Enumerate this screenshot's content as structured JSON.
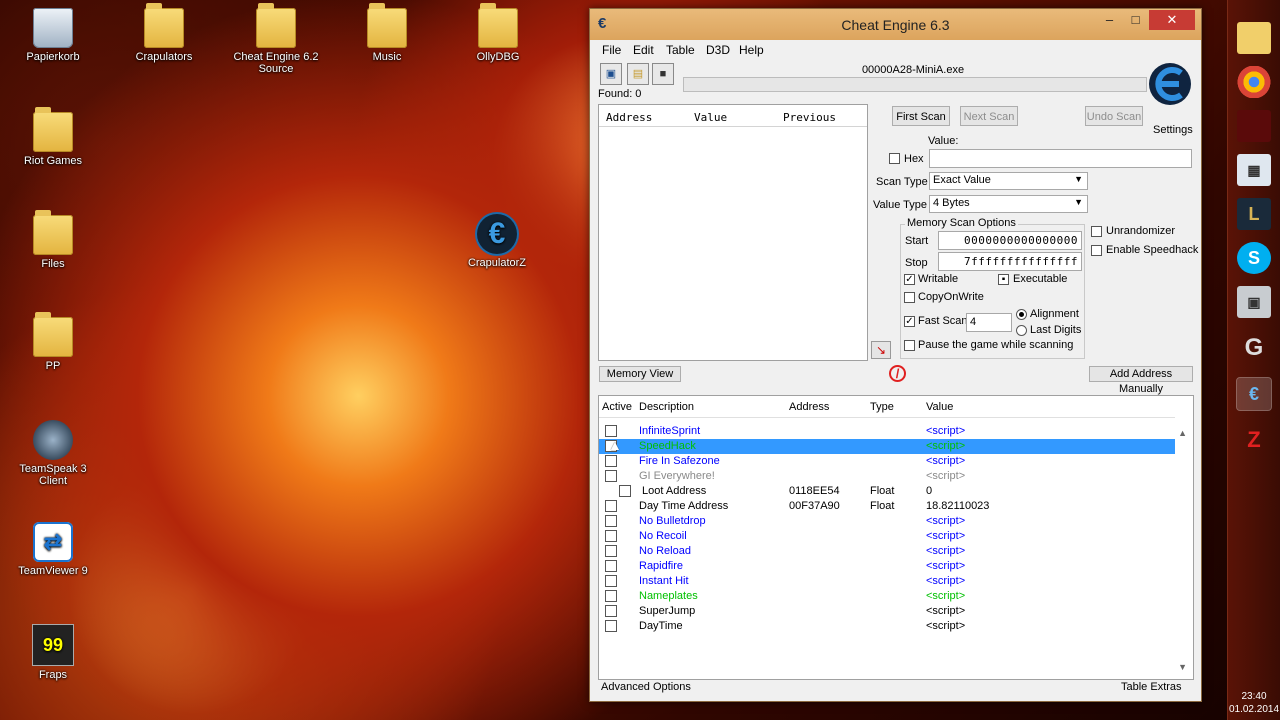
{
  "desktop": {
    "icons": [
      "Papierkorb",
      "Crapulators",
      "Cheat Engine 6.2 Source",
      "Music",
      "OllyDBG",
      "Riot Games",
      "Files",
      "CrapulatorZ",
      "PP",
      "TeamSpeak 3 Client",
      "TeamViewer 9",
      "Fraps"
    ]
  },
  "taskbar": {
    "time": "23:40",
    "date": "01.02.2014"
  },
  "window": {
    "title": "Cheat Engine 6.3",
    "menu": [
      "File",
      "Edit",
      "Table",
      "D3D",
      "Help"
    ],
    "process": "00000A28-MiniA.exe",
    "found": "Found: 0",
    "results_headers": [
      "Address",
      "Value",
      "Previous"
    ],
    "scan": {
      "first_scan": "First Scan",
      "next_scan": "Next Scan",
      "undo_scan": "Undo Scan",
      "settings": "Settings",
      "value_label": "Value:",
      "hex_label": "Hex",
      "scan_type_label": "Scan Type",
      "scan_type_value": "Exact Value",
      "value_type_label": "Value Type",
      "value_type_value": "4 Bytes",
      "memory_options_title": "Memory Scan Options",
      "start_label": "Start",
      "start_value": "0000000000000000",
      "stop_label": "Stop",
      "stop_value": "7fffffffffffffff",
      "writable": "Writable",
      "executable": "Executable",
      "copyonwrite": "CopyOnWrite",
      "fast_scan": "Fast Scan",
      "fast_scan_value": "4",
      "alignment": "Alignment",
      "last_digits": "Last Digits",
      "pause": "Pause the game while scanning",
      "unrandomizer": "Unrandomizer",
      "speedhack": "Enable Speedhack"
    },
    "memory_view": "Memory View",
    "add_address": "Add Address Manually",
    "table_headers": [
      "Active",
      "Description",
      "Address",
      "Type",
      "Value"
    ],
    "rows": [
      {
        "desc": "InfiniteSprint",
        "address": "",
        "type": "",
        "value": "<script>",
        "color": "blue"
      },
      {
        "desc": "SpeedHack",
        "address": "",
        "type": "",
        "value": "<script>",
        "color": "green"
      },
      {
        "desc": "Fire In Safezone",
        "address": "",
        "type": "",
        "value": "<script>",
        "color": "blue"
      },
      {
        "desc": "GI Everywhere!",
        "address": "",
        "type": "",
        "value": "<script>",
        "color": "gray"
      },
      {
        "desc": "Loot Address",
        "address": "0118EE54",
        "type": "Float",
        "value": "0",
        "color": "black"
      },
      {
        "desc": "Day Time Address",
        "address": "00F37A90",
        "type": "Float",
        "value": "18.82110023",
        "color": "black"
      },
      {
        "desc": "No Bulletdrop",
        "address": "",
        "type": "",
        "value": "<script>",
        "color": "blue"
      },
      {
        "desc": "No Recoil",
        "address": "",
        "type": "",
        "value": "<script>",
        "color": "blue"
      },
      {
        "desc": "No Reload",
        "address": "",
        "type": "",
        "value": "<script>",
        "color": "blue"
      },
      {
        "desc": "Rapidfire",
        "address": "",
        "type": "",
        "value": "<script>",
        "color": "blue"
      },
      {
        "desc": "Instant Hit",
        "address": "",
        "type": "",
        "value": "<script>",
        "color": "blue"
      },
      {
        "desc": "Nameplates",
        "address": "",
        "type": "",
        "value": "<script>",
        "color": "green"
      },
      {
        "desc": "SuperJump",
        "address": "",
        "type": "",
        "value": "<script>",
        "color": "black"
      },
      {
        "desc": "DayTime",
        "address": "",
        "type": "",
        "value": "<script>",
        "color": "black"
      }
    ],
    "advanced_options": "Advanced Options",
    "table_extras": "Table Extras"
  }
}
